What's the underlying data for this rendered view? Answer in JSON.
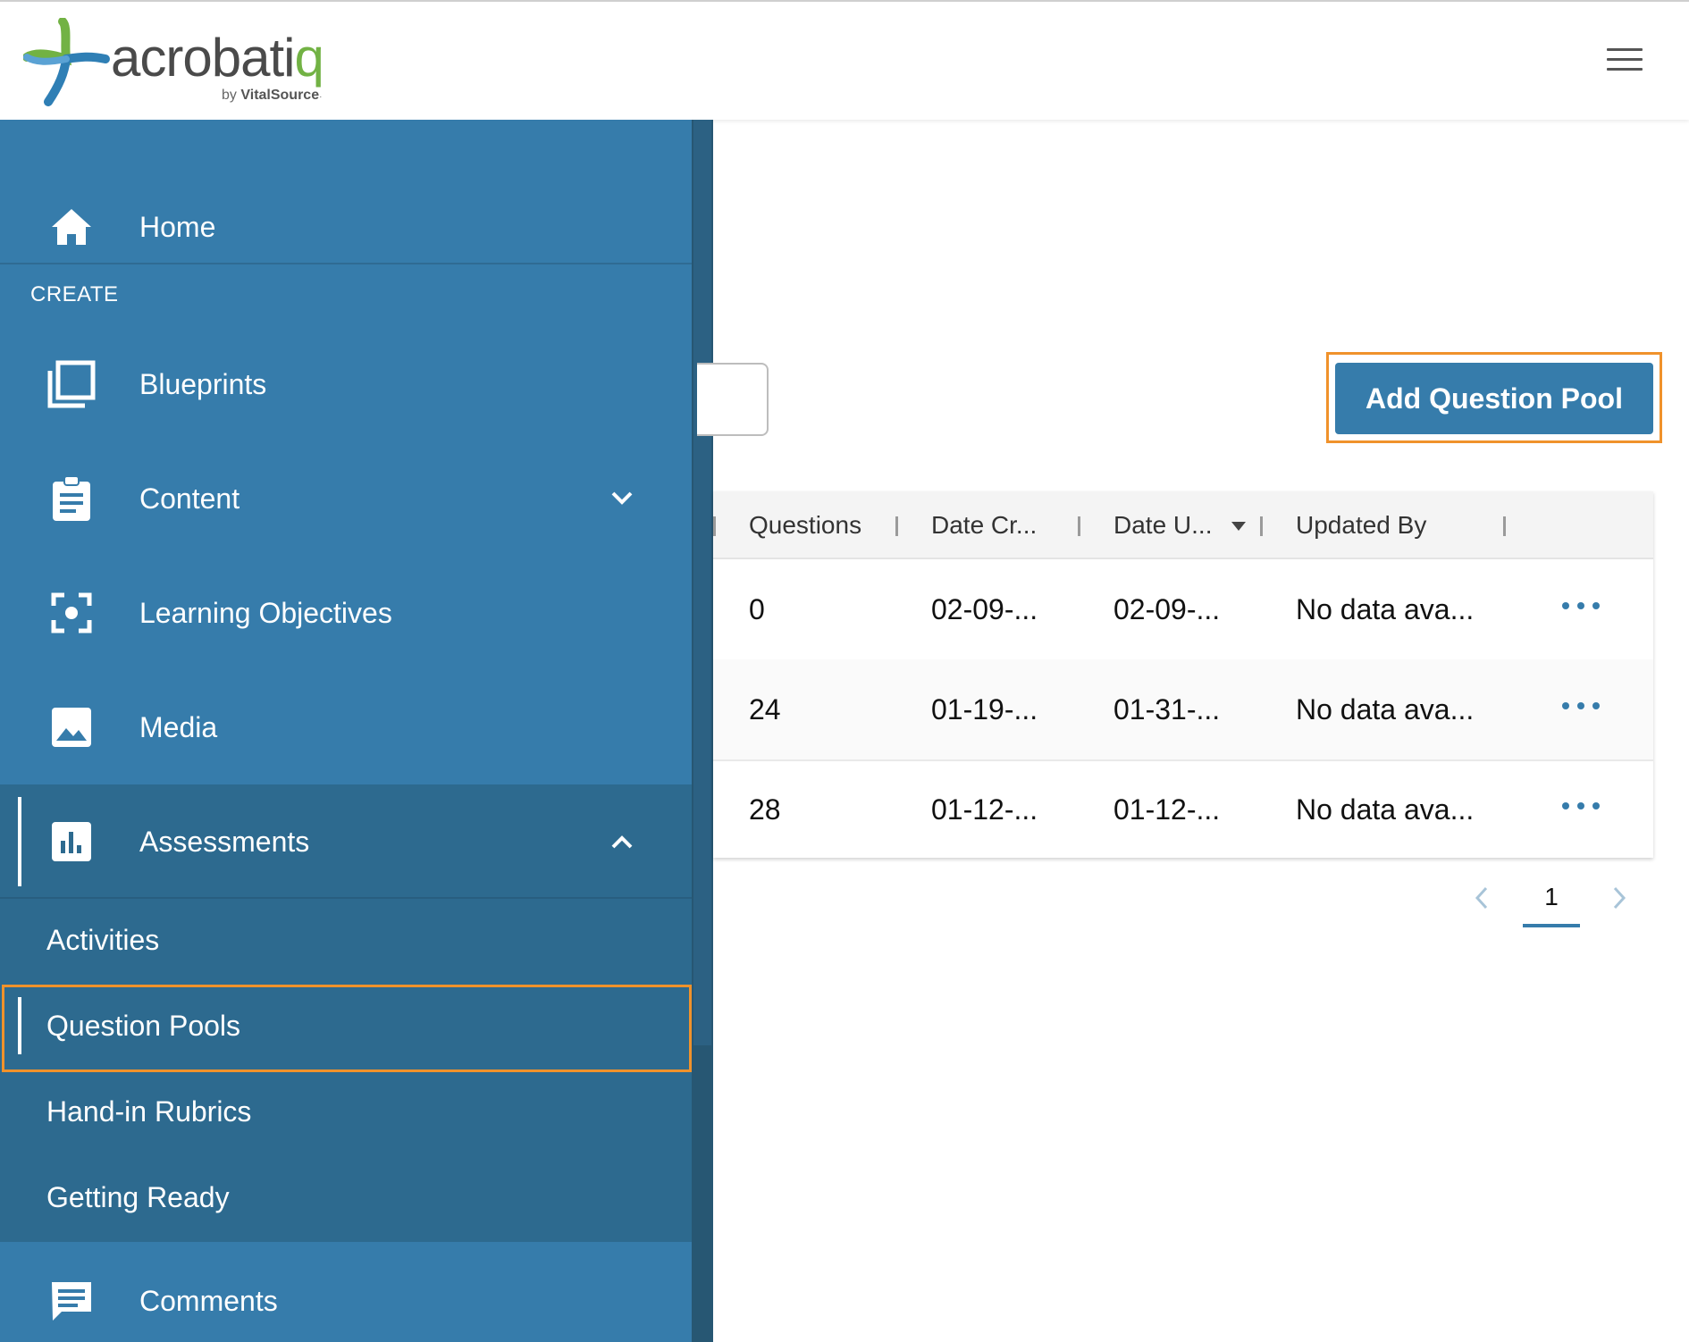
{
  "header": {
    "logo_text_main": "acrobati",
    "logo_text_q": "q",
    "logo_by": "by",
    "logo_brand": "VitalSource",
    "logo_brand_mark": "·"
  },
  "sidebar": {
    "home_label": "Home",
    "section_create": "CREATE",
    "items": [
      {
        "label": "Blueprints",
        "icon": "blueprints-icon"
      },
      {
        "label": "Content",
        "icon": "clipboard-icon"
      },
      {
        "label": "Learning Objectives",
        "icon": "focus-target-icon"
      },
      {
        "label": "Media",
        "icon": "image-icon"
      },
      {
        "label": "Assessments",
        "icon": "bar-chart-icon"
      }
    ],
    "assessments_sub": [
      "Activities",
      "Question Pools",
      "Hand-in Rubrics",
      "Getting Ready"
    ],
    "comments_label": "Comments",
    "active_sub": "Question Pools"
  },
  "main": {
    "add_button_label": "Add Question Pool",
    "table": {
      "headers": [
        "Questions",
        "Date Cr...",
        "Date U...",
        "Updated By"
      ],
      "rows": [
        {
          "questions": "0",
          "date_created": "02-09-...",
          "date_updated": "02-09-...",
          "updated_by": "No data ava..."
        },
        {
          "questions": "24",
          "date_created": "01-19-...",
          "date_updated": "01-31-...",
          "updated_by": "No data ava..."
        },
        {
          "questions": "28",
          "date_created": "01-12-...",
          "date_updated": "01-12-...",
          "updated_by": "No data ava..."
        }
      ]
    },
    "pagination": {
      "current_page": "1"
    }
  },
  "colors": {
    "sidebar": "#367cab",
    "sidebar_dark": "#2d6a8f",
    "accent": "#367cab",
    "highlight": "#f0922b"
  }
}
